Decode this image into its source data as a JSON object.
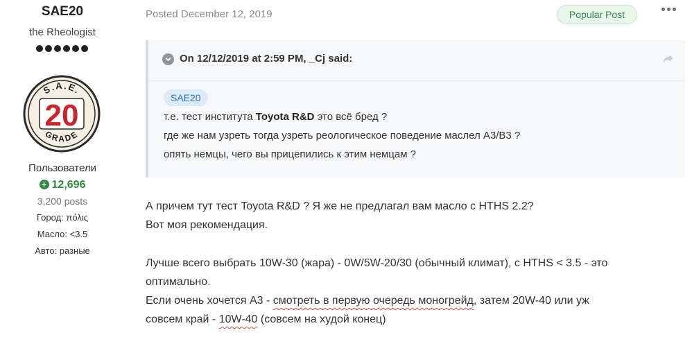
{
  "author": {
    "name": "SAE20",
    "title": "the Rheologist",
    "rank_dots": 6,
    "avatar": {
      "top": "S.A.E.",
      "number": "20",
      "bottom": "GRADE"
    },
    "group": "Пользователи",
    "reputation": "12,696",
    "posts": "3,200 posts",
    "fields": [
      "Город: πόλις",
      "Масло: <3.5",
      "Авто: разные"
    ]
  },
  "post": {
    "posted": "Posted December 12, 2019",
    "badge": "Popular Post",
    "more_icon": "more-options-icon",
    "quote": {
      "cite": "On 12/12/2019 at 2:59 PM, _Cj said:",
      "mention": "SAE20",
      "line1_before": "т.е. тест института ",
      "line1_bold": "Toyota R&D",
      "line1_after": " это всё бред ?",
      "line2": "где же нам узреть тогда узреть реологическое поведение маслел А3/В3 ?",
      "line3": "опять немцы, чего вы прицепились к этим немцам ?"
    },
    "body": {
      "p1_line1": "А причем тут тест Toyota R&D ? Я же не предлагал вам масло с HTHS 2.2?",
      "p1_line2": "Вот моя рекомендация.",
      "p2_line1": "Лучше всего выбрать 10W-30 (жара) - 0W/5W-20/30 (обычный климат), с HTHS < 3.5 - это",
      "p2_line2": "оптимально.",
      "p3_line1_a": "Если очень хочется А3 - ",
      "p3_line1_b": "смотреть в первую очередь моногрейд",
      "p3_line1_c": ", затем 20W-40 или уж",
      "p3_line2_a": "совсем край - ",
      "p3_line2_b": "10W-40",
      "p3_line2_c": " (совсем на худой конец)"
    }
  },
  "colors": {
    "reputation": "#2f8a3f",
    "badge_bg": "#e9f6ec",
    "mention_bg": "#dcebf8",
    "underline": "#d84a4a"
  }
}
